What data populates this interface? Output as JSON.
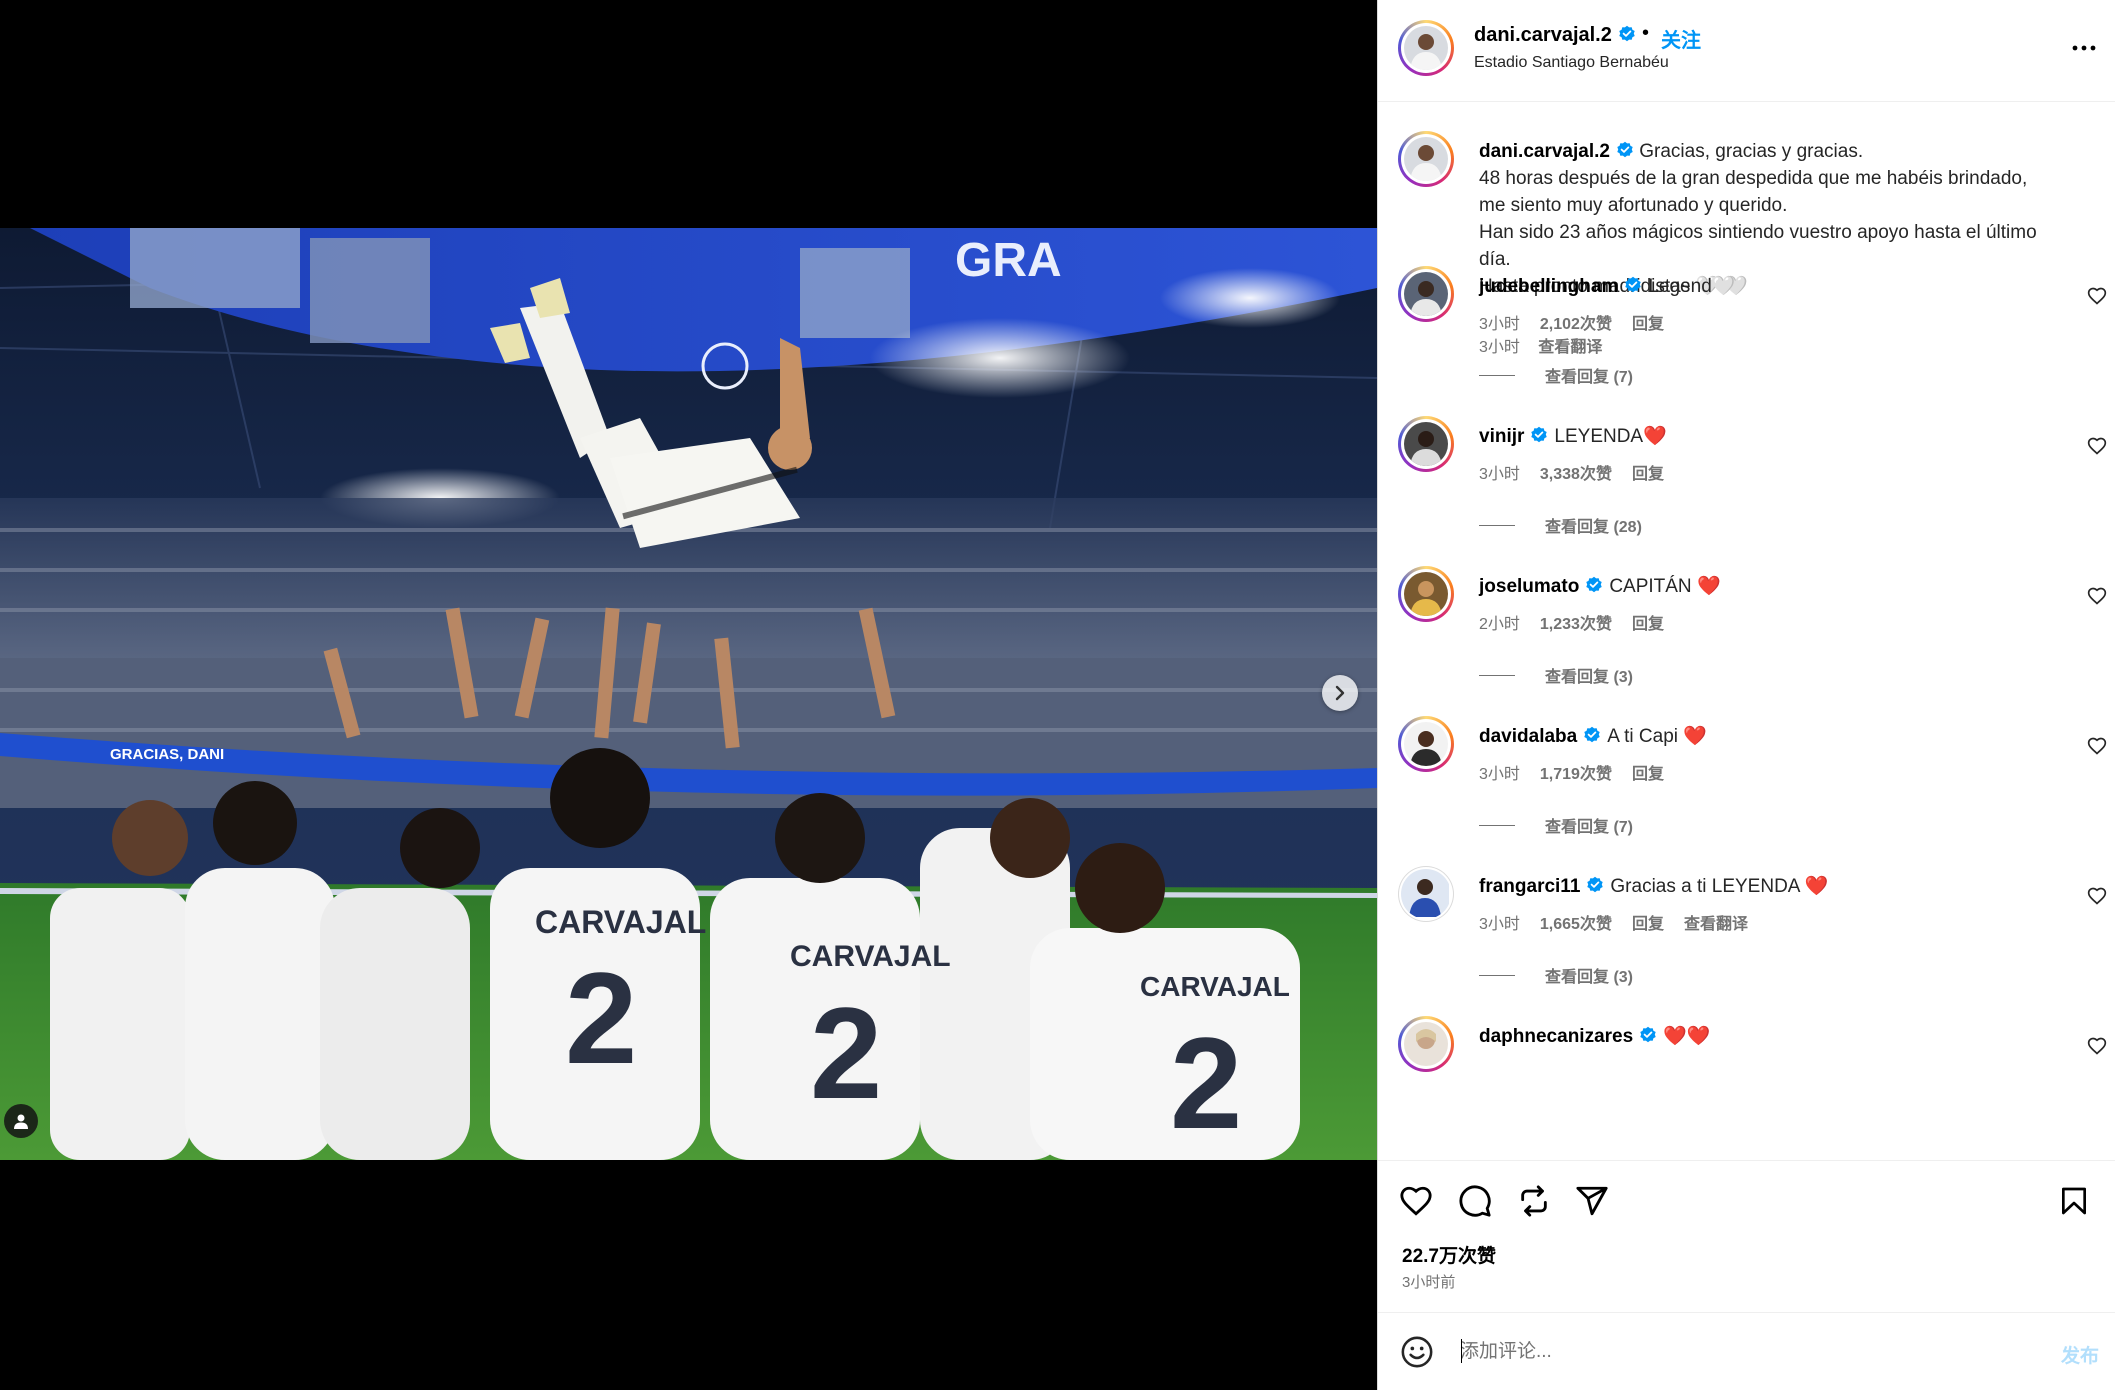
{
  "post": {
    "username": "dani.carvajal.2",
    "separator": "•",
    "follow_label": "关注",
    "location": "Estadio Santiago Bernabéu",
    "more_icon": "more-horizontal-icon",
    "caption_lines": [
      "Gracias, gracias y gracias.",
      "48 horas después de la gran despedida que me habéis brindado,",
      "me siento muy afortunado y querido.",
      "Han sido 23 años mágicos sintiendo vuestro apoyo hasta el último",
      "día.",
      "Hasta pronto madridistas 🤍 🤍"
    ],
    "caption_time": "3小时",
    "caption_translate": "查看翻译"
  },
  "photo": {
    "banner_text": "GRACIAS, DANI",
    "screen_text": "GRA",
    "jersey_name": "CARVAJAL",
    "jersey_number": "2"
  },
  "comments": [
    {
      "username": "judebellingham",
      "verified": true,
      "text": "Legend🤍",
      "time": "3小时",
      "likes": "2,102次赞",
      "reply": "回复",
      "replies": "查看回复 (7)"
    },
    {
      "username": "vinijr",
      "verified": true,
      "text": "LEYENDA",
      "emoji": "❤️",
      "time": "3小时",
      "likes": "3,338次赞",
      "reply": "回复",
      "replies": "查看回复 (28)"
    },
    {
      "username": "joselumato",
      "verified": true,
      "text": "CAPITÁN",
      "emoji": "❤️",
      "time": "2小时",
      "likes": "1,233次赞",
      "reply": "回复",
      "replies": "查看回复 (3)"
    },
    {
      "username": "davidalaba",
      "verified": true,
      "text": "A ti Capi",
      "emoji": "❤️",
      "time": "3小时",
      "likes": "1,719次赞",
      "reply": "回复",
      "replies": "查看回复 (7)"
    },
    {
      "username": "frangarci11",
      "verified": true,
      "text": "Gracias a ti LEYENDA",
      "emoji": "❤️",
      "time": "3小时",
      "likes": "1,665次赞",
      "reply": "回复",
      "translate": "查看翻译",
      "replies": "查看回复 (3)"
    },
    {
      "username": "daphnecanizares",
      "verified": true,
      "text": "",
      "emoji": "❤️❤️"
    }
  ],
  "actions": {
    "like_icon": "heart-icon",
    "comment_icon": "comment-icon",
    "repost_icon": "repost-icon",
    "share_icon": "share-icon",
    "save_icon": "bookmark-icon",
    "likes_count": "22.7万次赞",
    "posted_ago": "3小时前"
  },
  "composer": {
    "emoji_icon": "emoji-icon",
    "placeholder": "添加评论...",
    "post_label": "发布"
  },
  "colors": {
    "accent": "#0095f6",
    "secondary_text": "#737373",
    "heart": "#ff3040",
    "post_disabled": "#b2dffc"
  }
}
